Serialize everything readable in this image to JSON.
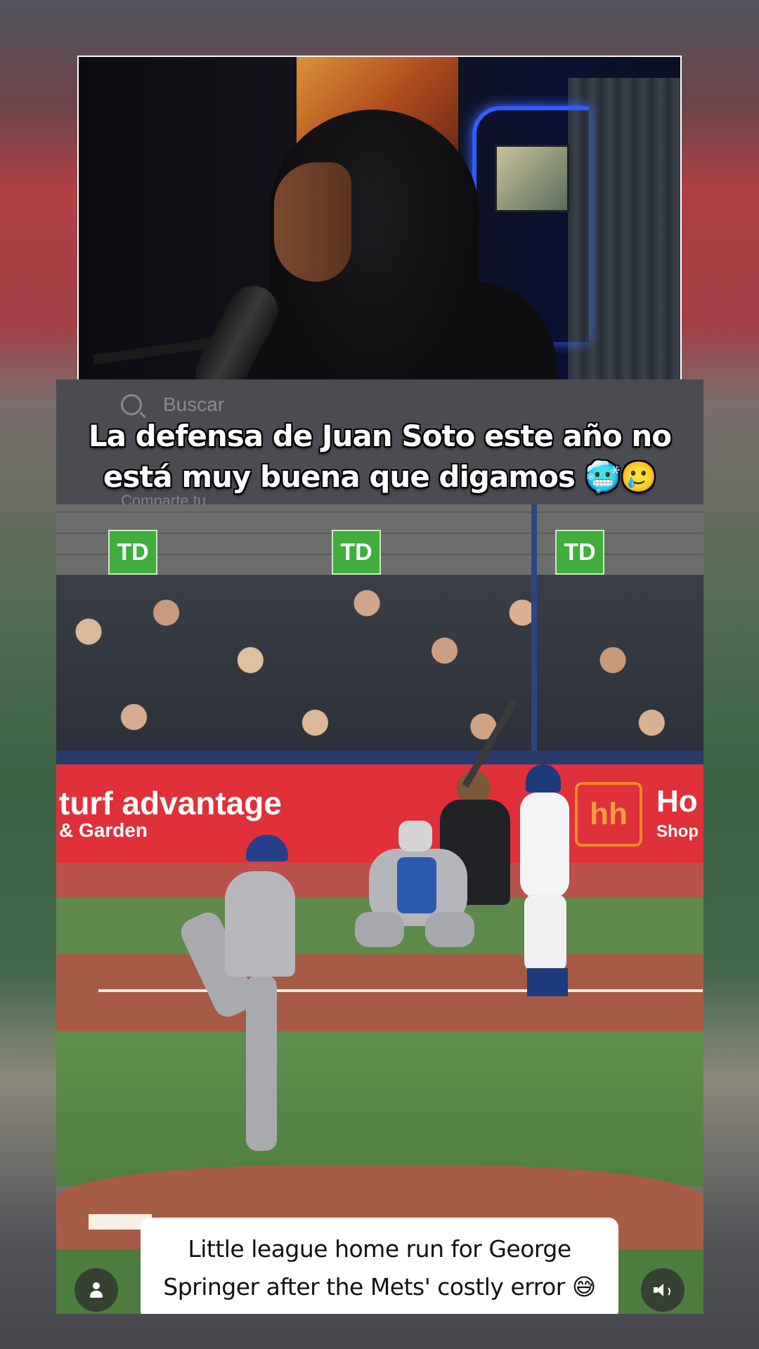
{
  "overlay": {
    "caption_line1": "La defensa de Juan Soto este año no",
    "caption_line2": "está muy buena que digamos 🥶🥲",
    "ghost_search": "Buscar",
    "ghost_share": "Comparte tu"
  },
  "video": {
    "ad_left_line1": "turf advantage",
    "ad_left_line2": "& Garden",
    "ad_right_line1": "Ho",
    "ad_right_line2": "Shop",
    "sponsor_logo": "TD",
    "hh_logo": "hh"
  },
  "caption_bubble": {
    "line1": "Little league home run for George",
    "line2": "Springer after the Mets' costly error 😅"
  },
  "icons": {
    "profile": "person-icon",
    "volume": "speaker-icon"
  },
  "colors": {
    "ad_red": "#e0303a",
    "td_green": "#3fae3c",
    "neon_blue": "#2f5cff"
  }
}
